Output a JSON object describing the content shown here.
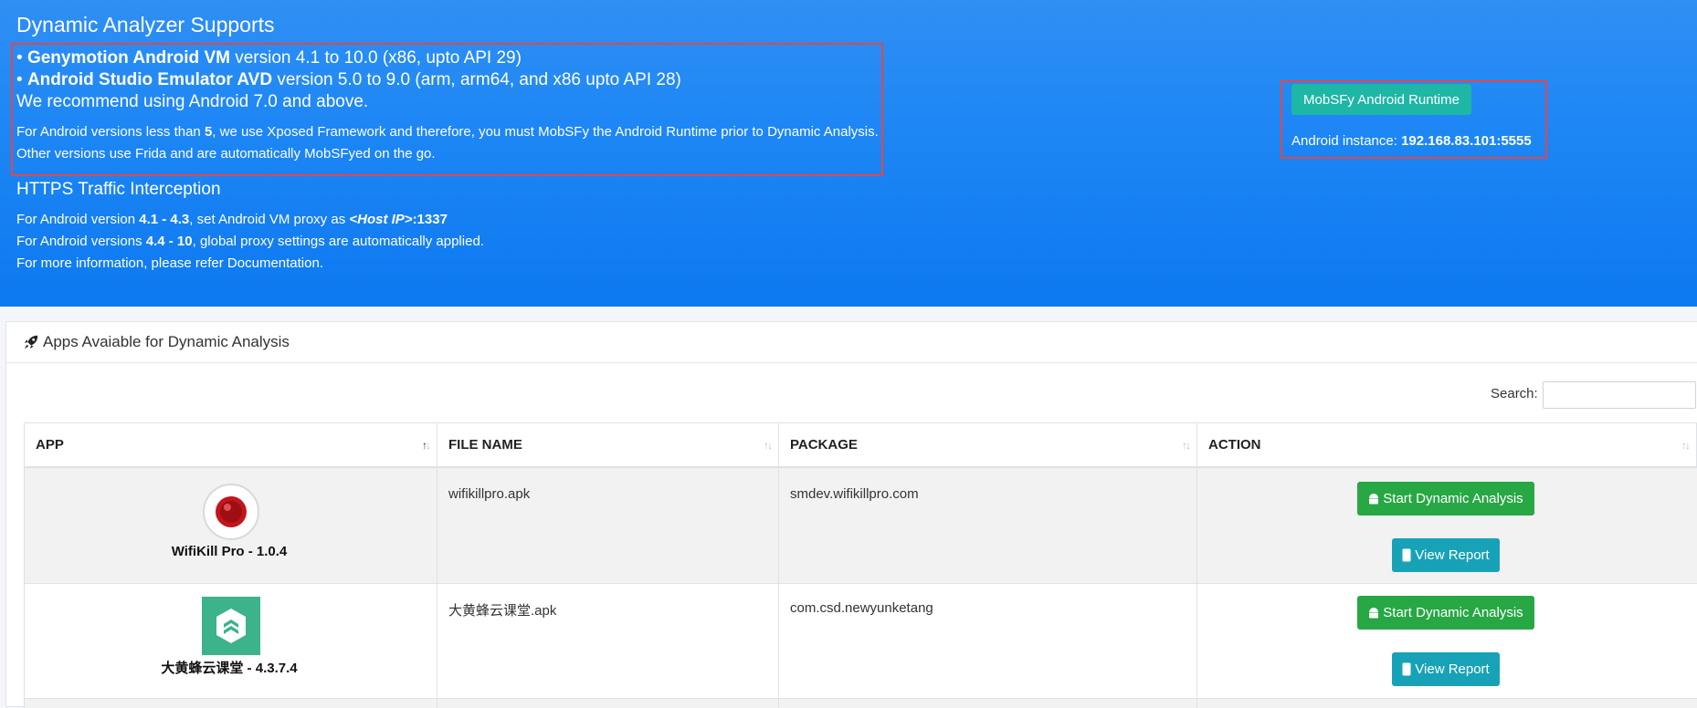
{
  "hero": {
    "title": "Dynamic Analyzer Supports",
    "genymotion": {
      "bullet": "•",
      "name": "Genymotion Android VM",
      "rest": " version 4.1 to 10.0 (x86, upto API 29)"
    },
    "avd": {
      "bullet": "•",
      "name": "Android Studio Emulator AVD",
      "rest": " version 5.0 to 9.0 (arm, arm64, and x86 upto API 28)"
    },
    "recommend": "We recommend using Android 7.0 and above.",
    "xposed_pre": "For Android versions less than ",
    "xposed_num": "5",
    "xposed_post": ", we use Xposed Framework and therefore, you must MobSFy the Android Runtime prior to Dynamic Analysis.",
    "frida": "Other versions use Frida and are automatically MobSFyed on the go.",
    "https_title": "HTTPS Traffic Interception",
    "proxy1_pre": "For Android version ",
    "proxy1_ver": "4.1 - 4.3",
    "proxy1_mid": ", set Android VM proxy as ",
    "proxy1_host": "<Host IP>",
    "proxy1_port": ":1337",
    "proxy2_pre": "For Android versions ",
    "proxy2_ver": "4.4 - 10",
    "proxy2_post": ", global proxy settings are automatically applied.",
    "proxy3": "For more information, please refer Documentation.",
    "mobsfy_button": "MobSFy Android Runtime",
    "instance_label": "Android instance: ",
    "instance_value": "192.168.83.101:5555"
  },
  "card": {
    "title": "Apps Avaiable for Dynamic Analysis",
    "search_label": "Search:",
    "search_value": ""
  },
  "table": {
    "headers": [
      "APP",
      "FILE NAME",
      "PACKAGE",
      "ACTION"
    ],
    "rows": [
      {
        "app": "WifiKill Pro - 1.0.4",
        "file": "wifikillpro.apk",
        "package": "smdev.wifikillpro.com",
        "start": "Start Dynamic Analysis",
        "view": "View Report"
      },
      {
        "app": "大黄蜂云课堂 - 4.3.7.4",
        "file": "大黄蜂云课堂.apk",
        "package": "com.csd.newyunketang",
        "start": "Start Dynamic Analysis",
        "view": "View Report"
      }
    ]
  },
  "colors": {
    "hero": "#1e87f5",
    "highlight_border": "#e0474c",
    "mobsfy": "#1eb6a5",
    "start_button": "#28a745",
    "view_button": "#17a2b8"
  }
}
